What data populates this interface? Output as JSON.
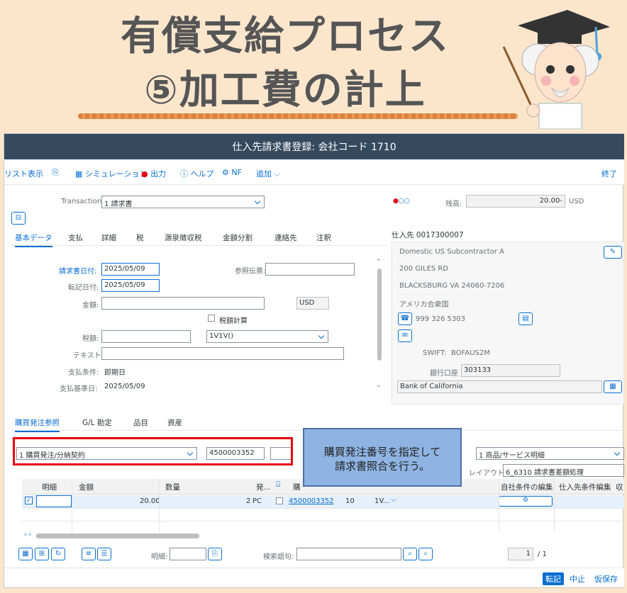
{
  "banner": {
    "line1": "有償支給プロセス",
    "line2": "⑤加工費の計上"
  },
  "window": {
    "title": "仕入先請求書登録: 会社コード 1710"
  },
  "toolbar": {
    "worklist": "リスト表示",
    "simulation": "シミュレーション",
    "output": "出力",
    "help": "ヘルプ",
    "nf": "NF",
    "add": "追加",
    "end": "終了"
  },
  "header": {
    "transaction_label": "Transaction",
    "transaction_value": "1 請求書",
    "balance_label": "残高:",
    "balance_value": "20.00-",
    "balance_currency": "USD"
  },
  "tabs": [
    "基本データ",
    "支払",
    "詳細",
    "税",
    "源泉徴収税",
    "金額分割",
    "連絡先",
    "注釈"
  ],
  "basic": {
    "invoice_date_label": "請求書日付:",
    "invoice_date": "2025/05/09",
    "reference_label": "参照伝票:",
    "reference": "",
    "posting_date_label": "転記日付:",
    "posting_date": "2025/05/09",
    "amount_label": "金額:",
    "amount": "",
    "currency": "USD",
    "calc_tax_label": "税額計算",
    "tax_amount_label": "税額:",
    "tax_amount": "",
    "tax_code": "1V1V()",
    "text_label": "テキスト:",
    "text": "",
    "payment_terms_label": "支払条件:",
    "payment_terms": "即期日",
    "baseline_date_label": "支払基準日:",
    "baseline_date": "2025/05/09"
  },
  "vendor": {
    "title": "仕入先 0017300007",
    "name": "Domestic US Subcontractor A",
    "street": "200 GILES RD",
    "city": "BLACKSBURG VA  24060-7206",
    "country": "アメリカ合衆国",
    "phone": "999 326 5303",
    "swift_label": "SWIFT:",
    "swift": "BOFAUS2M",
    "bank_account_label": "銀行口座",
    "bank_account": "303133",
    "bank_name": "Bank of California"
  },
  "lower_tabs": [
    "購買発注参照",
    "G/L 勘定",
    "品目",
    "資産"
  ],
  "po_ref": {
    "type": "1 購買発注/分納契約",
    "po_number": "4500003352",
    "item_type": "1 商品/サービス明細",
    "layout_label": "レイアウト",
    "layout": "6_6310 請求書差額処理"
  },
  "callout": {
    "line1": "購買発注番号を指定して",
    "line2": "請求書照合を行う。"
  },
  "grid": {
    "headers": [
      "明細",
      "金額",
      "数量",
      "発...",
      "購",
      "自社条件の編集",
      "仕入先条件編集",
      "収"
    ],
    "row": {
      "amount": "20.00",
      "qty": "2",
      "unit": "PC",
      "po": "4500003352",
      "item": "10",
      "col": "1V..."
    }
  },
  "grid_footer": {
    "item_label": "明細:",
    "search_label": "検索語句:",
    "page": "1",
    "page_total": "/ 1"
  },
  "footer": {
    "post": "転記",
    "cancel": "中止",
    "park": "仮保存"
  }
}
